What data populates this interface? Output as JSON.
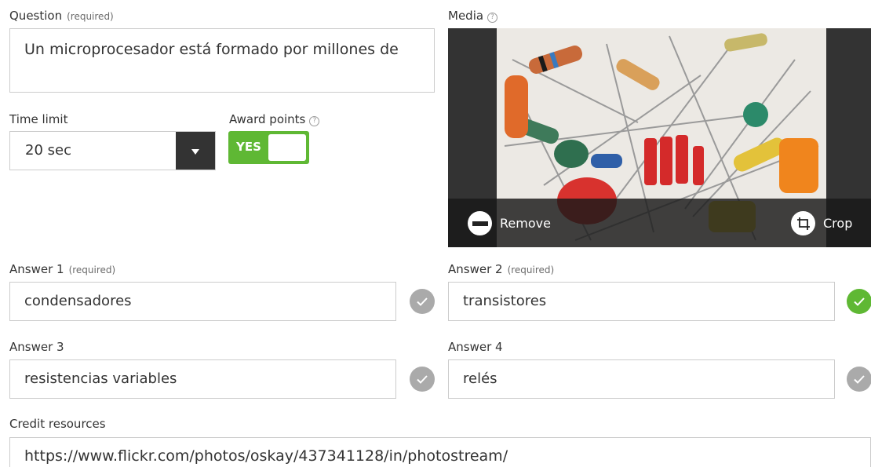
{
  "question": {
    "label": "Question",
    "required": "(required)",
    "text": "Un microprocesador está formado por millones de"
  },
  "time_limit": {
    "label": "Time limit",
    "value": "20 sec",
    "icon": "caret-down-icon"
  },
  "award_points": {
    "label": "Award points",
    "toggle_label": "YES",
    "enabled": true,
    "color": "#5fb834"
  },
  "media": {
    "label": "Media",
    "image_subject": "electronic components",
    "remove_label": "Remove",
    "crop_label": "Crop"
  },
  "answers": [
    {
      "label": "Answer 1",
      "required": "(required)",
      "value": "condensadores",
      "correct": false
    },
    {
      "label": "Answer 2",
      "required": "(required)",
      "value": "transistores",
      "correct": true
    },
    {
      "label": "Answer 3",
      "required": "",
      "value": "resistencias variables",
      "correct": false
    },
    {
      "label": "Answer 4",
      "required": "",
      "value": "relés",
      "correct": false
    }
  ],
  "credit": {
    "label": "Credit resources",
    "value": "https://www.flickr.com/photos/oskay/437341128/in/photostream/"
  },
  "colors": {
    "accent_green": "#5fb834",
    "dark": "#333333",
    "check_off": "#aaaaaa",
    "border": "#cccccc"
  }
}
